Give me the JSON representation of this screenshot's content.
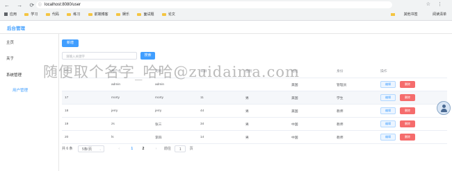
{
  "browser": {
    "nav_icons": "← → ⟳",
    "url": "localhost:8080/user",
    "toolbar_icons": "☆ ⋮",
    "bookmarks": [
      "应用",
      "学习",
      "代码",
      "练习",
      "前端博客",
      "娱乐",
      "面试题",
      "论文"
    ],
    "bookmarks_right": [
      "其他书签",
      "阅读清单"
    ]
  },
  "app": {
    "brand": "后台管理"
  },
  "sidebar": {
    "items": [
      "主页",
      "关于",
      "系统管理",
      "用户管理"
    ]
  },
  "toolbar": {
    "add_label": "新增",
    "search_placeholder": "请输入关键字",
    "search_label": "搜索"
  },
  "table": {
    "columns": [
      "ID",
      "用户名",
      "昵称",
      "年龄",
      "性别",
      "地址",
      "身份",
      "操作"
    ],
    "rows": [
      [
        "",
        "admin",
        "admin",
        "",
        "",
        "美国",
        "管理员"
      ],
      [
        "17",
        "morty",
        "morty",
        "11",
        "男",
        "美国",
        "学生"
      ],
      [
        "18",
        "jerry",
        "jerry",
        "44",
        "男",
        "美国",
        "教师"
      ],
      [
        "19",
        "zs",
        "张三",
        "34",
        "男",
        "中国",
        "教师"
      ],
      [
        "20",
        "ls",
        "李四",
        "14",
        "男",
        "中国",
        "教师"
      ]
    ],
    "edit_label": "编辑",
    "delete_label": "删除"
  },
  "pagination": {
    "total": "共 6 条",
    "page_size": "5条/页",
    "pages": [
      "1",
      "2"
    ],
    "goto_label": "前往",
    "goto_value": "1",
    "page_unit": "页"
  },
  "watermark": "随便取个名字_哈哈@zuidaima.com"
}
